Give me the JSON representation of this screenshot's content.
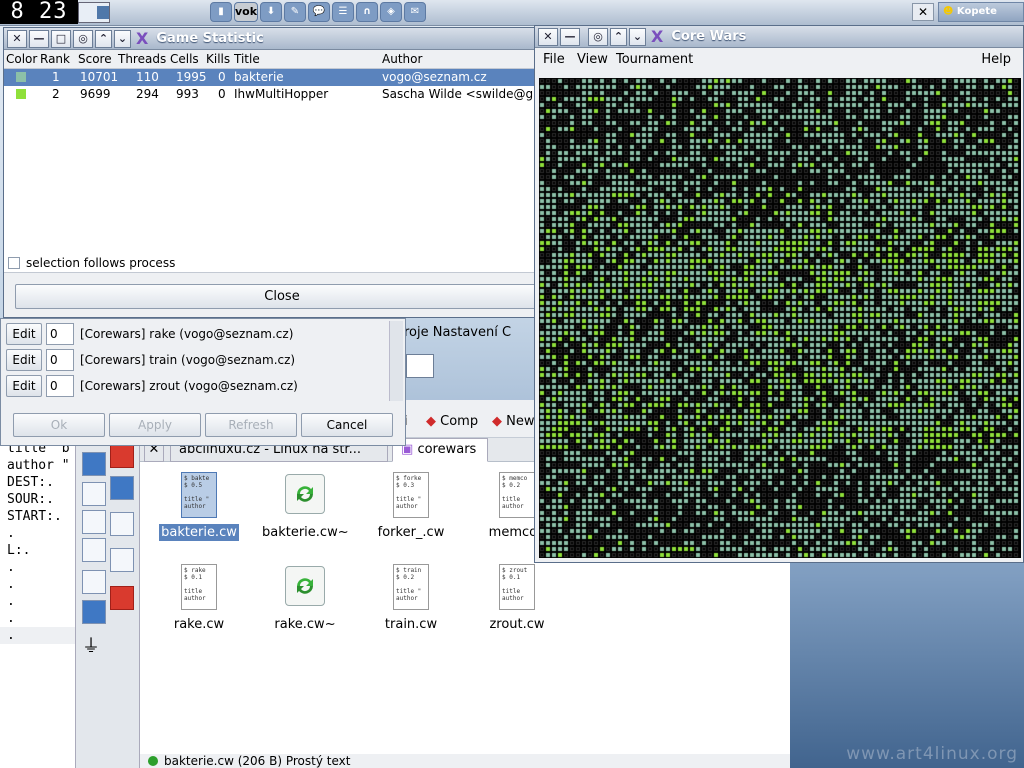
{
  "topbar": {
    "clock": "8 23",
    "tray_vok": "vok"
  },
  "kopete": {
    "close": "✕",
    "label": "Kopete"
  },
  "watermark": "www.art4linux.org",
  "game_statistic": {
    "title": "Game Statistic",
    "columns": [
      "Color",
      "Rank",
      "Score",
      "Threads",
      "Cells",
      "Kills",
      "Title",
      "Author"
    ],
    "rows": [
      {
        "color": "#8cc0a8",
        "rank": "1",
        "score": "10701",
        "threads": "110",
        "cells": "1995",
        "kills": "0",
        "title": "bakterie",
        "author": "vogo@seznam.cz"
      },
      {
        "color": "#8fe03a",
        "rank": "2",
        "score": "9699",
        "threads": "294",
        "cells": "993",
        "kills": "0",
        "title": "IhwMultiHopper",
        "author": "Sascha Wilde <swilde@gm"
      }
    ],
    "checkbox_label": "selection follows process",
    "close_label": "Close"
  },
  "warrior_dialog": {
    "rows": [
      {
        "edit": "Edit",
        "value": "0",
        "label": "[Corewars] rake (vogo@seznam.cz)"
      },
      {
        "edit": "Edit",
        "value": "0",
        "label": "[Corewars] train (vogo@seznam.cz)"
      },
      {
        "edit": "Edit",
        "value": "0",
        "label": "[Corewars] zrout (vogo@seznam.cz)"
      }
    ],
    "buttons": {
      "ok": "Ok",
      "apply": "Apply",
      "refresh": "Refresh",
      "cancel": "Cancel"
    }
  },
  "core_wars": {
    "title": "Core Wars",
    "menu": {
      "file": "File",
      "view": "View",
      "tournament": "Tournament",
      "help": "Help"
    }
  },
  "editor": {
    "lines": [
      "title \"b",
      "author \"",
      "",
      "DEST:.",
      "SOUR:.",
      "START:.",
      ".",
      "L:.",
      ".",
      ".",
      ".",
      ".",
      "."
    ]
  },
  "file_manager": {
    "menu_fragment": "roje  Nastavení  C",
    "toolbar": {
      "left": "i",
      "comp": "Comp",
      "new": "New"
    },
    "tabs": [
      "abclinuxu.cz - Linux na stř...",
      "corewars"
    ],
    "files": [
      {
        "name": "bakterie.cw",
        "type": "doc",
        "preview": "$ bakte\n$ 0.5\n\ntitle \"\nauthor",
        "selected": true
      },
      {
        "name": "bakterie.cw~",
        "type": "recycle",
        "selected": false
      },
      {
        "name": "forker_.cw",
        "type": "doc",
        "preview": "$ forke\n$ 0.3\n\ntitle \"\nauthor",
        "selected": false
      },
      {
        "name": "memcop",
        "type": "doc",
        "preview": "$ memco\n$ 0.2\n\ntitle\nauthor",
        "selected": false
      },
      {
        "name": "rake.cw",
        "type": "doc",
        "preview": "$ rake\n$ 0.1\n\ntitle\nauthor",
        "selected": false
      },
      {
        "name": "rake.cw~",
        "type": "recycle",
        "selected": false
      },
      {
        "name": "train.cw",
        "type": "doc",
        "preview": "$ train\n$ 0.2\n\ntitle \"\nauthor",
        "selected": false
      },
      {
        "name": "zrout.cw",
        "type": "doc",
        "preview": "$ zrout\n$ 0.1\n\ntitle\nauthor",
        "selected": false
      }
    ],
    "status": "bakterie.cw (206 B)  Prostý text"
  },
  "colors": {
    "teal": "#8cc0a8",
    "green": "#8fe03a"
  }
}
